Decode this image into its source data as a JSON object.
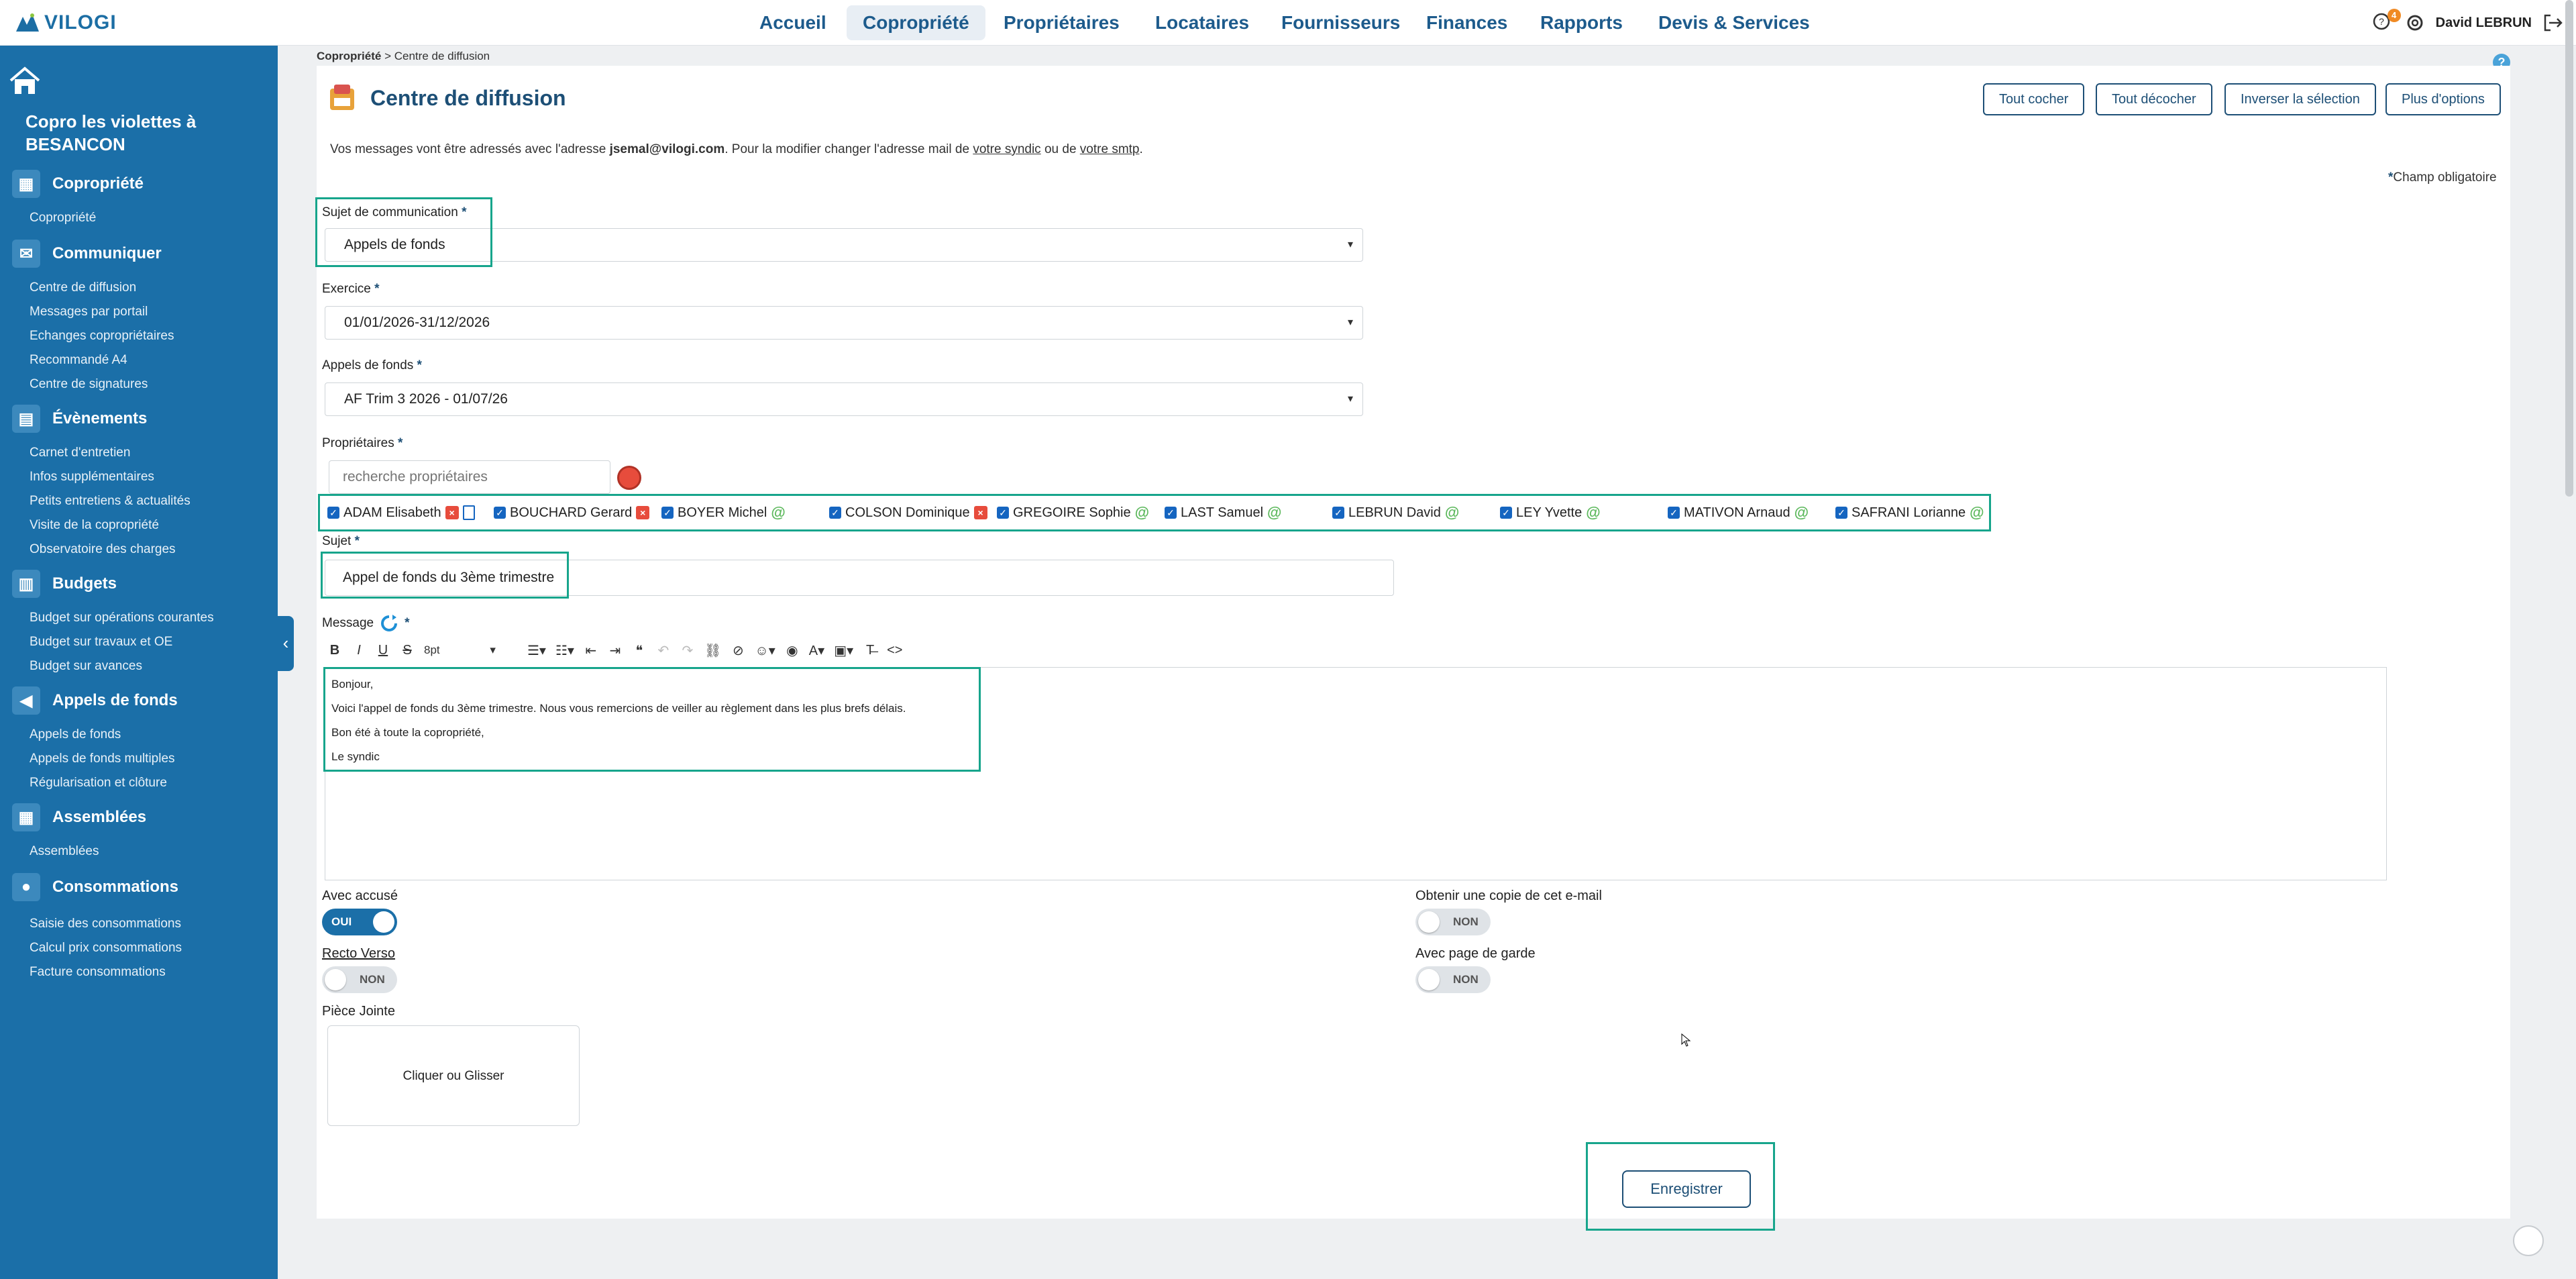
{
  "app": {
    "logo_text": "VILOGI"
  },
  "nav": {
    "items": [
      {
        "label": "Accueil"
      },
      {
        "label": "Copropriété"
      },
      {
        "label": "Propriétaires"
      },
      {
        "label": "Locataires"
      },
      {
        "label": "Fournisseurs"
      },
      {
        "label": "Finances"
      },
      {
        "label": "Rapports"
      },
      {
        "label": "Devis & Services"
      }
    ],
    "active": "Copropriété",
    "notifications_count": "4",
    "user_name": "David LEBRUN"
  },
  "sidebar": {
    "copro_name": "Copro les violettes à BESANCON",
    "sections": [
      {
        "title": "Copropriété",
        "icon": "grid-icon",
        "items": [
          "Copropriété"
        ]
      },
      {
        "title": "Communiquer",
        "icon": "mail-icon",
        "items": [
          "Centre de diffusion",
          "Messages par portail",
          "Echanges copropriétaires",
          "Recommandé A4",
          "Centre de signatures"
        ]
      },
      {
        "title": "Évènements",
        "icon": "calendar-icon",
        "items": [
          "Carnet d'entretien",
          "Infos supplémentaires",
          "Petits entretiens & actualités",
          "Visite de la copropriété",
          "Observatoire des charges"
        ]
      },
      {
        "title": "Budgets",
        "icon": "calculator-icon",
        "items": [
          "Budget sur opérations courantes",
          "Budget sur travaux et OE",
          "Budget sur avances"
        ]
      },
      {
        "title": "Appels de fonds",
        "icon": "megaphone-icon",
        "items": [
          "Appels de fonds",
          "Appels de fonds multiples",
          "Régularisation et clôture"
        ]
      },
      {
        "title": "Assemblées",
        "icon": "grid-icon",
        "items": [
          "Assemblées"
        ]
      },
      {
        "title": "Consommations",
        "icon": "drop-icon",
        "items": [
          "Saisie des consommations",
          "Calcul prix consommations",
          "Facture consommations"
        ]
      }
    ]
  },
  "breadcrumb": {
    "root": "Copropriété",
    "sep": ">",
    "current": "Centre de diffusion"
  },
  "page": {
    "title": "Centre de diffusion",
    "buttons": {
      "check_all": "Tout cocher",
      "uncheck_all": "Tout décocher",
      "invert": "Inverser la sélection",
      "more": "Plus d'options"
    },
    "info_prefix": "Vos messages vont être adressés avec l'adresse",
    "info_email": "jsemal@vilogi.com",
    "info_middle": ". Pour la modifier changer l'adresse mail de",
    "info_link1": "votre syndic",
    "info_or": "ou de",
    "info_link2": "votre smtp",
    "info_end": ".",
    "required_note": "Champ obligatoire"
  },
  "form": {
    "subject_type": {
      "label": "Sujet de communication",
      "value": "Appels de fonds"
    },
    "exercice": {
      "label": "Exercice",
      "value": "01/01/2026-31/12/2026"
    },
    "appels": {
      "label": "Appels de fonds",
      "value": "AF Trim 3 2026 - 01/07/26"
    },
    "owners": {
      "label": "Propriétaires",
      "search_placeholder": "recherche propriétaires",
      "list": [
        {
          "name": "ADAM Elisabeth",
          "status": "x",
          "doc": true
        },
        {
          "name": "BOUCHARD Gerard",
          "status": "x",
          "doc": false
        },
        {
          "name": "BOYER Michel",
          "status": "@",
          "doc": false
        },
        {
          "name": "COLSON Dominique",
          "status": "x",
          "doc": false
        },
        {
          "name": "GREGOIRE Sophie",
          "status": "@",
          "doc": false
        },
        {
          "name": "LAST Samuel",
          "status": "@",
          "doc": false
        },
        {
          "name": "LEBRUN David",
          "status": "@",
          "doc": false
        },
        {
          "name": "LEY Yvette",
          "status": "@",
          "doc": false
        },
        {
          "name": "MATIVON Arnaud",
          "status": "@",
          "doc": false
        },
        {
          "name": "SAFRANI Lorianne",
          "status": "@",
          "doc": false
        }
      ]
    },
    "sujet": {
      "label": "Sujet",
      "value": "Appel de fonds du 3ème trimestre"
    },
    "message": {
      "label": "Message",
      "font_size": "8pt",
      "lines": [
        "Bonjour,",
        "Voici l'appel de fonds du 3ème trimestre. Nous vous remercions de veiller au règlement dans les plus brefs délais.",
        "Bon été à toute la copropriété,",
        "Le syndic"
      ]
    },
    "accuse": {
      "label": "Avec accusé",
      "state": "OUI"
    },
    "recto_verso": {
      "label": "Recto Verso",
      "state": "NON"
    },
    "copie": {
      "label": "Obtenir une copie de cet e-mail",
      "state": "NON"
    },
    "page_garde": {
      "label": "Avec page de garde",
      "state": "NON"
    },
    "attachment": {
      "label": "Pièce Jointe",
      "dropzone": "Cliquer ou Glisser"
    },
    "save_label": "Enregistrer"
  },
  "colors": {
    "sidebar": "#1b6fa8",
    "highlight": "#17a58c",
    "primary": "#1d4f76"
  }
}
